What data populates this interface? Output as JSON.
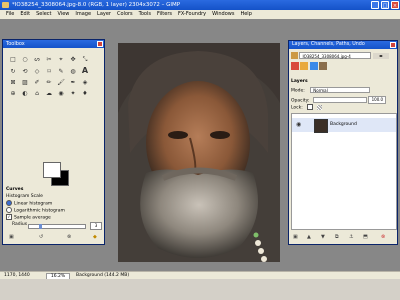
{
  "window": {
    "title": "*IO38254_3308064.jpg-8.0 (RGB, 1 layer) 2304x3072 – GIMP"
  },
  "menu": [
    "File",
    "Edit",
    "Select",
    "View",
    "Image",
    "Layer",
    "Colors",
    "Tools",
    "Filters",
    "FX-Foundry",
    "Windows",
    "Help"
  ],
  "toolbox": {
    "title": "Toolbox",
    "tools": [
      "□",
      "○",
      "ᔕ",
      "✂",
      "⌖",
      "✥",
      "⤡",
      "↻",
      "⟲",
      "◇",
      "⌑",
      "✎",
      "◍",
      "A",
      "⊠",
      "▨",
      "✐",
      "✏",
      "🖌",
      "✒",
      "◈",
      "⊕",
      "◐",
      "⌂",
      "☁",
      "◉",
      "✦",
      "♦"
    ],
    "options": {
      "title": "Curves",
      "histogram_scale": "Histogram Scale",
      "linear": "Linear histogram",
      "log": "Logarithmic histogram",
      "sample_average": "Sample average",
      "radius_label": "Radius",
      "radius_value": "3"
    }
  },
  "layers": {
    "title": "Layers, Channels, Paths, Undo",
    "image_select": "IO38254_3308064.jpg-4",
    "section": "Layers",
    "mode_label": "Mode:",
    "mode_value": "Normal",
    "opacity_label": "Opacity:",
    "opacity_value": "100.0",
    "lock_label": "Lock:",
    "layer_name": "Background"
  },
  "status": {
    "coords": "1170, 1440",
    "zoom": "16.2%",
    "info": "Background (144.2 MB)"
  }
}
